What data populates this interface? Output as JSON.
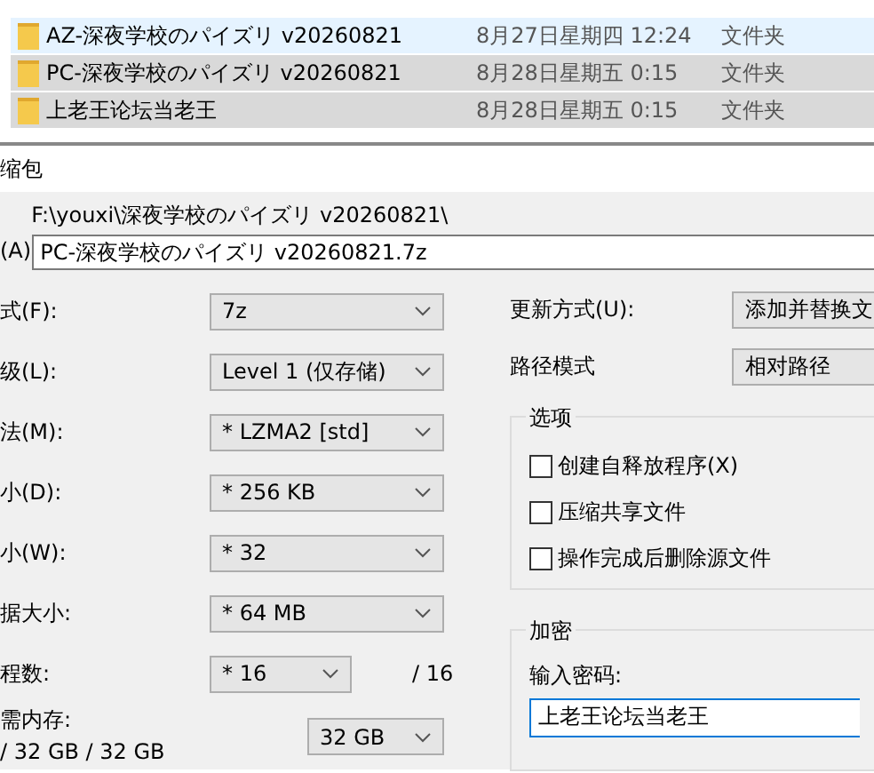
{
  "file_list": [
    {
      "name": "AZ-深夜学校のパイズリ v20260821",
      "date": "8月27日星期四 12:24",
      "type": "文件夹",
      "hovered": true,
      "selected": false
    },
    {
      "name": "PC-深夜学校のパイズリ v20260821",
      "date": "8月28日星期五 0:15",
      "type": "文件夹",
      "hovered": false,
      "selected": true
    },
    {
      "name": "上老王论坛当老王",
      "date": "8月28日星期五 0:15",
      "type": "文件夹",
      "hovered": false,
      "selected": true
    }
  ],
  "dialog": {
    "title": "缩包",
    "archive_label": "(A)",
    "archive_folder": "F:\\youxi\\深夜学校のパイズリ v20260821\\",
    "archive_name": "PC-深夜学校のパイズリ v20260821.7z",
    "left_fields": [
      {
        "kind": "combo",
        "label": "式(F):",
        "value": "7z"
      },
      {
        "kind": "combo",
        "label": "级(L):",
        "value": "Level 1 (仅存储)"
      },
      {
        "kind": "combo",
        "label": "法(M):",
        "value": "* LZMA2 [std]"
      },
      {
        "kind": "combo",
        "label": "小(D):",
        "value": "* 256 KB"
      },
      {
        "kind": "combo",
        "label": "小(W):",
        "value": "* 32"
      },
      {
        "kind": "combo",
        "label": "据大小:",
        "value": "* 64 MB"
      },
      {
        "kind": "threads",
        "label": "程数:",
        "value": "* 16",
        "suffix": "/ 16"
      },
      {
        "kind": "memory",
        "label": "需内存:",
        "note": "/ 32 GB / 32 GB",
        "value": "32 GB"
      }
    ],
    "right_fields": [
      {
        "label": "更新方式(U):",
        "value": "添加并替换文"
      },
      {
        "label": "路径模式",
        "value": "相对路径"
      }
    ],
    "options": {
      "title": "选项",
      "items": [
        {
          "label": "创建自释放程序(X)",
          "checked": false
        },
        {
          "label": "压缩共享文件",
          "checked": false
        },
        {
          "label": "操作完成后删除源文件",
          "checked": false
        }
      ]
    },
    "encryption": {
      "title": "加密",
      "label": "输入密码:",
      "value": "上老王论坛当老王"
    }
  }
}
